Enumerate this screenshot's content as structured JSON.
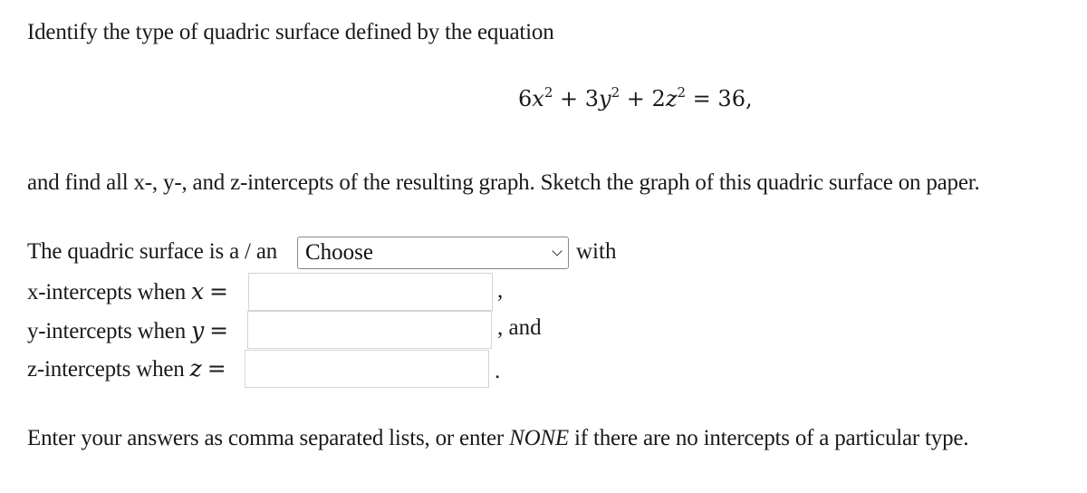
{
  "question": {
    "intro": "Identify the type of quadric surface defined by the equation",
    "equation": {
      "terms": [
        {
          "coef": "6",
          "var": "x",
          "exp": "2"
        },
        {
          "coef": "3",
          "var": "y",
          "exp": "2"
        },
        {
          "coef": "2",
          "var": "z",
          "exp": "2"
        }
      ],
      "plus": "+",
      "equals": "=",
      "rhs": "36",
      "trail": ","
    },
    "continuation": "and find all x-, y-, and z-intercepts of the resulting graph. Sketch the graph of this quadric surface on paper."
  },
  "form": {
    "surface_label": "The quadric surface is a / an",
    "surface_select": {
      "selected": "Choose"
    },
    "with_label": "with",
    "x_label": "x-intercepts when",
    "x_var": "x",
    "y_label": "y-intercepts when",
    "y_var": "y",
    "z_label": "z-intercepts when",
    "z_var": "z",
    "eq_sign": "=",
    "x_value": "",
    "y_value": "",
    "z_value": "",
    "x_suffix": ",",
    "y_suffix": ", and",
    "z_suffix": "."
  },
  "instructions": {
    "before": "Enter your answers as comma separated lists, or enter",
    "none_word": "NONE",
    "after": "if there are no intercepts of a particular type."
  }
}
